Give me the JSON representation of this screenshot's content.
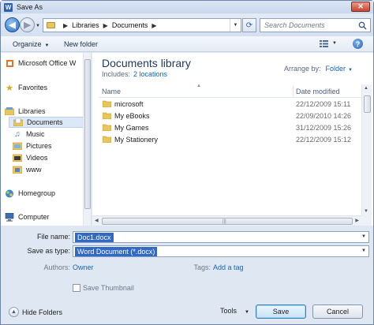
{
  "window": {
    "title": "Save As",
    "close_glyph": "✕"
  },
  "navbar": {
    "breadcrumb": [
      "Libraries",
      "Documents"
    ],
    "search_placeholder": "Search Documents",
    "back_glyph": "◀",
    "forward_glyph": "▶",
    "refresh_glyph": "⟳"
  },
  "toolbar": {
    "organize": "Organize",
    "new_folder": "New folder",
    "help_glyph": "?"
  },
  "nav_pane": {
    "items": [
      {
        "label": "Microsoft Office W",
        "icon": "office-icon"
      },
      {
        "label": "Favorites",
        "icon": "star-icon"
      },
      {
        "label": "Libraries",
        "icon": "libraries-icon"
      },
      {
        "label": "Documents",
        "icon": "documents-icon",
        "selected": true
      },
      {
        "label": "Music",
        "icon": "music-icon"
      },
      {
        "label": "Pictures",
        "icon": "pictures-icon"
      },
      {
        "label": "Videos",
        "icon": "videos-icon"
      },
      {
        "label": "www",
        "icon": "library-folder-icon"
      },
      {
        "label": "Homegroup",
        "icon": "homegroup-icon"
      },
      {
        "label": "Computer",
        "icon": "computer-icon"
      }
    ]
  },
  "content": {
    "library_title": "Documents library",
    "includes_label": "Includes:",
    "includes_link": "2 locations",
    "arrange_label": "Arrange by:",
    "arrange_value": "Folder",
    "columns": {
      "name": "Name",
      "date": "Date modified"
    },
    "files": [
      {
        "name": "microsoft",
        "date": "22/12/2009 15:11"
      },
      {
        "name": "My eBooks",
        "date": "22/09/2010 14:26"
      },
      {
        "name": "My Games",
        "date": "31/12/2009 15:26"
      },
      {
        "name": "My Stationery",
        "date": "22/12/2009 15:12"
      }
    ]
  },
  "form": {
    "file_name_label": "File name:",
    "file_name_value": "Doc1.docx",
    "save_type_label": "Save as type:",
    "save_type_value": "Word Document (*.docx)",
    "authors_label": "Authors:",
    "authors_value": "Owner",
    "tags_label": "Tags:",
    "tags_value": "Add a tag",
    "save_thumbnail_label": "Save Thumbnail",
    "save_thumbnail_checked": false,
    "hide_folders": "Hide Folders",
    "tools": "Tools",
    "save": "Save",
    "cancel": "Cancel"
  },
  "colors": {
    "library_title": "#1e395b",
    "link": "#1565c0",
    "selection": "#3169c6"
  }
}
